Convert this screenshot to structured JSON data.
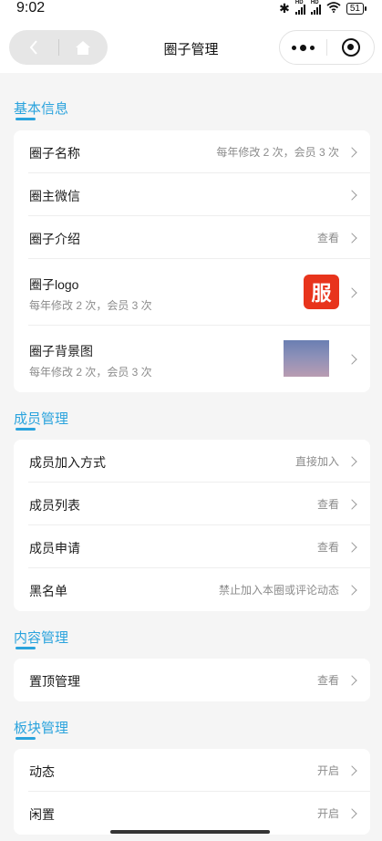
{
  "status_bar": {
    "time": "9:02",
    "battery": "51",
    "hd": "HD"
  },
  "nav": {
    "title": "圈子管理"
  },
  "sections": [
    {
      "title": "基本信息",
      "rows": [
        {
          "label": "圈子名称",
          "value": "每年修改 2 次，会员 3 次"
        },
        {
          "label": "圈主微信",
          "value": ""
        },
        {
          "label": "圈子介绍",
          "value": "查看"
        },
        {
          "label": "圈子logo",
          "sub": "每年修改 2 次，会员 3 次",
          "thumb_text": "服"
        },
        {
          "label": "圈子背景图",
          "sub": "每年修改 2 次，会员 3 次"
        }
      ]
    },
    {
      "title": "成员管理",
      "rows": [
        {
          "label": "成员加入方式",
          "value": "直接加入"
        },
        {
          "label": "成员列表",
          "value": "查看"
        },
        {
          "label": "成员申请",
          "value": "查看"
        },
        {
          "label": "黑名单",
          "value": "禁止加入本圈或评论动态"
        }
      ]
    },
    {
      "title": "内容管理",
      "rows": [
        {
          "label": "置顶管理",
          "value": "查看"
        }
      ]
    },
    {
      "title": "板块管理",
      "rows": [
        {
          "label": "动态",
          "value": "开启"
        },
        {
          "label": "闲置",
          "value": "开启"
        }
      ]
    }
  ],
  "colors": {
    "accent": "#2aa3dd",
    "logo_bg": "#e8341c"
  }
}
